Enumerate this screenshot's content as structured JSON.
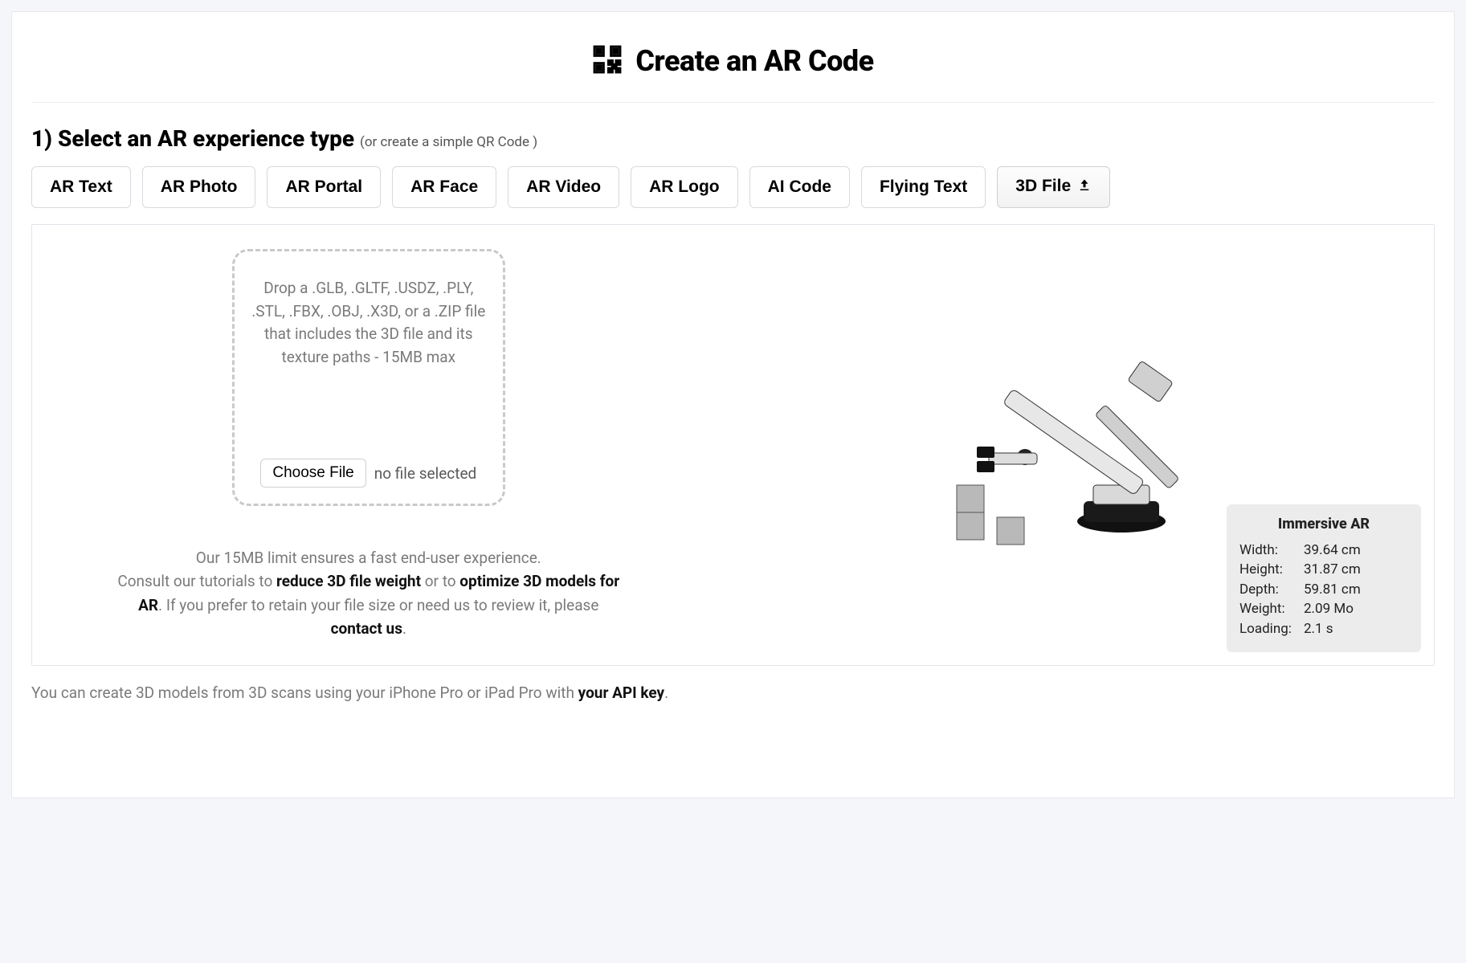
{
  "page_title": "Create an AR Code",
  "step1": {
    "heading": "1) Select an AR experience type",
    "sub_prefix": "(or create a simple ",
    "sub_link": "QR Code",
    "sub_suffix": " )"
  },
  "tabs": [
    {
      "label": "AR Text",
      "active": false
    },
    {
      "label": "AR Photo",
      "active": false
    },
    {
      "label": "AR Portal",
      "active": false
    },
    {
      "label": "AR Face",
      "active": false
    },
    {
      "label": "AR Video",
      "active": false
    },
    {
      "label": "AR Logo",
      "active": false
    },
    {
      "label": "AI Code",
      "active": false
    },
    {
      "label": "Flying Text",
      "active": false
    },
    {
      "label": "3D File",
      "active": true,
      "icon": "upload-icon"
    }
  ],
  "dropzone": {
    "text": "Drop a .GLB, .GLTF, .USDZ, .PLY, .STL, .FBX, .OBJ, .X3D, or a .ZIP file that includes the 3D file and its texture paths - 15MB max",
    "choose_label": "Choose File",
    "no_file": "no file selected"
  },
  "help": {
    "line1": "Our 15MB limit ensures a fast end-user experience.",
    "line2_a": "Consult our tutorials to ",
    "line2_b": "reduce 3D file weight",
    "line2_c": " or to ",
    "line2_d": "optimize 3D models for AR",
    "line2_e": ". If you prefer to retain your file size or need us to review it, please ",
    "line2_f": "contact us",
    "line2_g": "."
  },
  "preview": {
    "title": "Immersive AR",
    "rows": [
      {
        "k": "Width:",
        "v": "39.64 cm"
      },
      {
        "k": "Height:",
        "v": "31.87 cm"
      },
      {
        "k": "Depth:",
        "v": "59.81 cm"
      },
      {
        "k": "Weight:",
        "v": "2.09 Mo"
      },
      {
        "k": "Loading:",
        "v": "2.1 s"
      }
    ]
  },
  "footer": {
    "a": "You can create 3D models from 3D scans using your iPhone Pro or iPad Pro with ",
    "b": "your API key",
    "c": "."
  }
}
